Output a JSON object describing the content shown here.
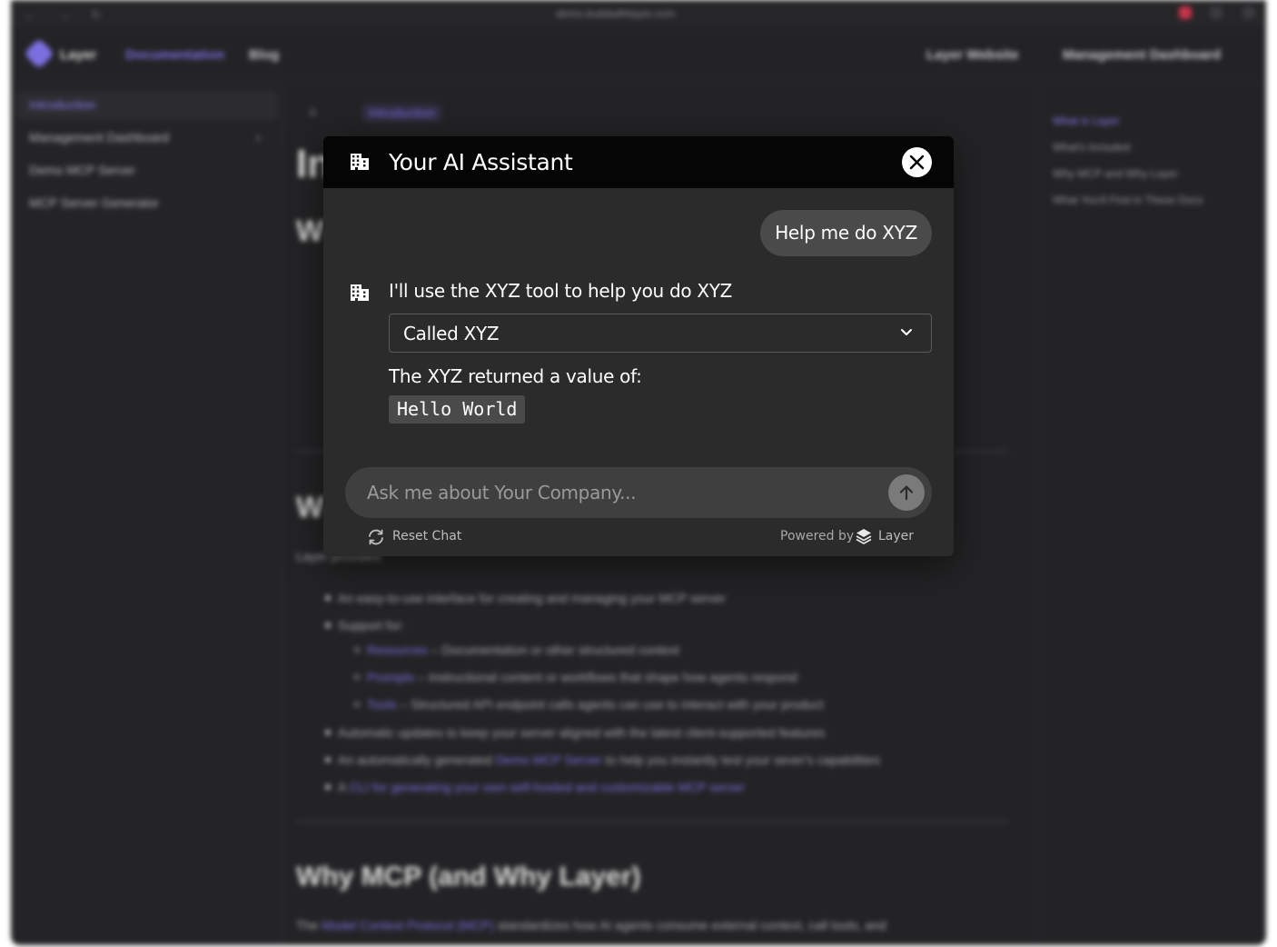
{
  "background": {
    "browser": {
      "url": "demo.buildwithlayer.com"
    },
    "nav": {
      "brand": "Layer",
      "links": [
        "Documentation",
        "Blog"
      ],
      "right_links": [
        "Layer Website",
        "Management Dashboard"
      ]
    },
    "sidebar": {
      "items": [
        "Introduction",
        "Management Dashboard",
        "Demo MCP Server",
        "MCP Server Generator"
      ]
    },
    "breadcrumb": {
      "current": "Introduction"
    },
    "content": {
      "heading_partial_1": "In",
      "heading_partial_2": "W",
      "heading_partial_3": "W",
      "intro_prefix": "Layer provides:",
      "bullets": [
        "An easy-to-use interface for creating and managing your MCP server",
        "Support for:",
        "Automatic updates to keep your server aligned with the latest client-supported features"
      ],
      "sub_bullets": [
        {
          "link": "Resources",
          "text": " – Documentation or other structured context"
        },
        {
          "link": "Prompts",
          "text": " – Instructional content or workflows that shape how agents respond"
        },
        {
          "link": "Tools",
          "text": " – Structured API endpoint calls agents can use to interact with your product"
        }
      ],
      "bullet_demo": {
        "prefix": "An automatically generated ",
        "link": "Demo MCP Server",
        "suffix": " to help you instantly test your sever's capabilities"
      },
      "bullet_cli": {
        "prefix": "A ",
        "link": "CLI for generating your own self-hosted and customizable MCP server"
      },
      "why_heading": "Why MCP (and Why Layer)",
      "why_para": {
        "prefix": "The ",
        "link": "Model Context Protocol (MCP)",
        "suffix": " standardizes how AI agents consume external context, call tools, and"
      }
    },
    "toc": [
      "What is Layer",
      "What's Included",
      "Why MCP and Why Layer",
      "What You'll Find in These Docs"
    ]
  },
  "modal": {
    "title": "Your AI Assistant",
    "header_icon": "building-icon",
    "user_message": "Help me do XYZ",
    "assistant_message": "I'll use the XYZ tool to help you do XYZ",
    "tool_call_label": "Called XYZ",
    "result_label": "The XYZ returned a value of:",
    "result_value": "Hello World",
    "input": {
      "placeholder": "Ask me about Your Company...",
      "value": ""
    },
    "reset_label": "Reset Chat",
    "powered_by": "Powered by",
    "brand": "Layer"
  },
  "colors": {
    "accent": "#7b6fe0",
    "modal_bg": "#2b2b2b",
    "header_bg": "#050505",
    "bubble_bg": "#4a4a4a"
  }
}
